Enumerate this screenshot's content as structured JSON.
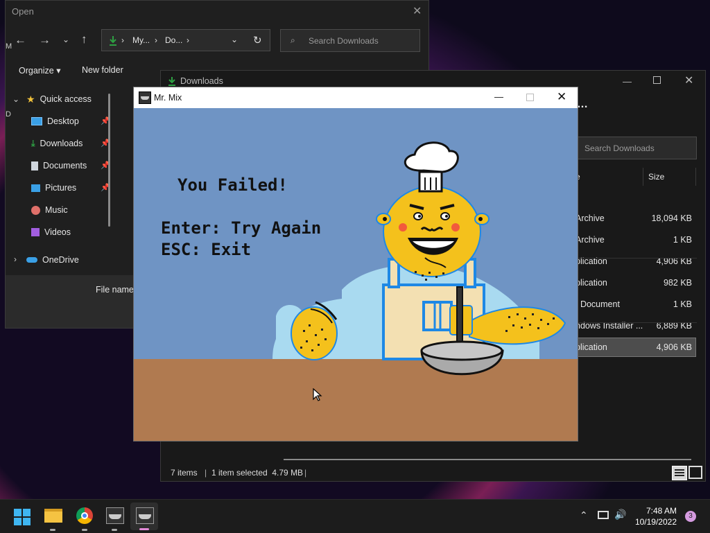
{
  "open_dialog": {
    "title": "Open",
    "address_parts": [
      "My...",
      "Do..."
    ],
    "search_placeholder": "Search Downloads",
    "organize_label": "Organize",
    "new_folder_label": "New folder",
    "file_name_label": "File name:",
    "nav": {
      "quick_access": "Quick access",
      "items": [
        "Desktop",
        "Downloads",
        "Documents",
        "Pictures",
        "Music",
        "Videos"
      ],
      "onedrive": "OneDrive"
    }
  },
  "downloads_window": {
    "title": "Downloads",
    "search_placeholder": "Search Downloads",
    "columns": {
      "name_fragment": "e",
      "size": "Size"
    },
    "rows": [
      {
        "type": "Archive",
        "size": "18,094 KB",
        "selected": false
      },
      {
        "type": "Archive",
        "size": "1 KB",
        "selected": false
      },
      {
        "type": "plication",
        "size": "4,906 KB",
        "selected": false
      },
      {
        "type": "plication",
        "size": "982 KB",
        "selected": false
      },
      {
        "type": "t Document",
        "size": "1 KB",
        "selected": false
      },
      {
        "type": "ndows Installer ...",
        "size": "6,889 KB",
        "selected": false
      },
      {
        "type": "plication",
        "size": "4,906 KB",
        "selected": true
      }
    ],
    "status": {
      "items": "7 items",
      "selected": "1 item selected  4.79 MB"
    }
  },
  "game_window": {
    "title": "Mr. Mix",
    "message": "You Failed!",
    "option_retry": "Enter: Try Again",
    "option_exit": "ESC: Exit"
  },
  "taskbar": {
    "time": "7:48 AM",
    "date": "10/19/2022",
    "notification_count": "3"
  },
  "colors": {
    "sky": "#6f94c4",
    "table": "#b07a50",
    "chef_skin": "#f4c11c",
    "shirt": "#a9daf0",
    "apron": "#f3e0b2",
    "accent_green": "#2ea043",
    "selection": "#4d4d4d"
  }
}
